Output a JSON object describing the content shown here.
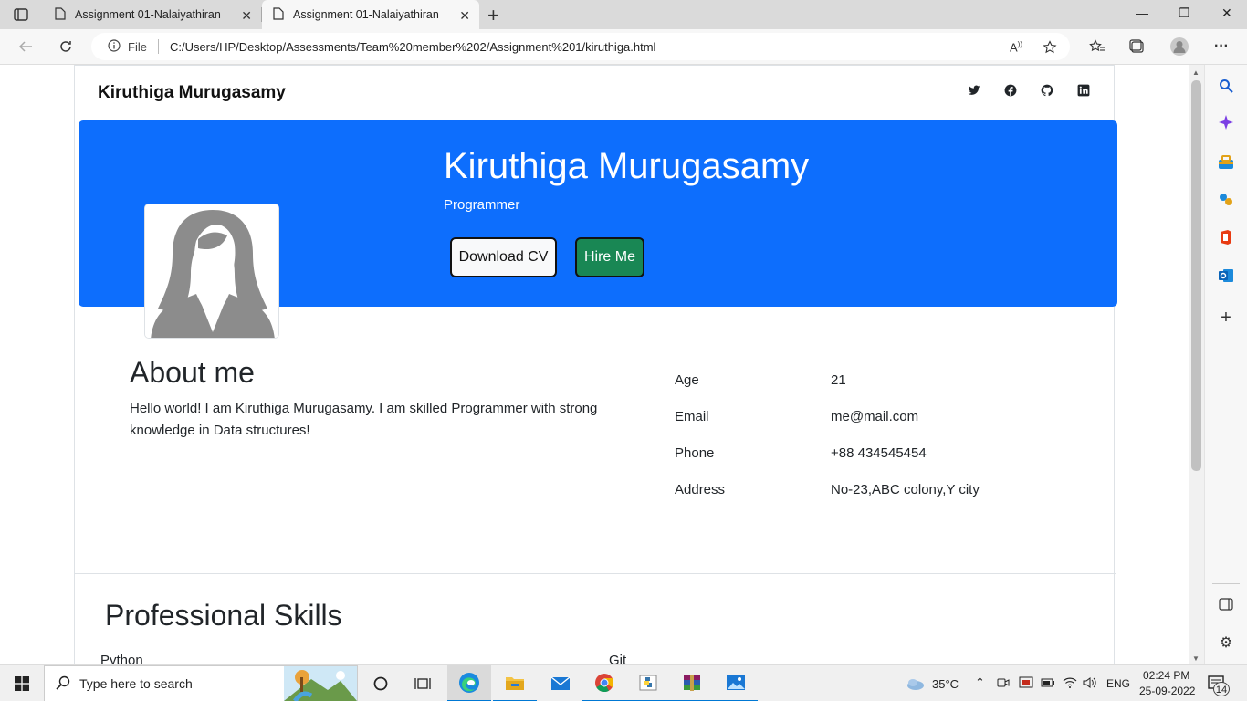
{
  "browser": {
    "tabs": [
      {
        "title": "Assignment 01-Nalaiyathiran",
        "active": false
      },
      {
        "title": "Assignment 01-Nalaiyathiran",
        "active": true
      }
    ],
    "url_label": "File",
    "url": "C:/Users/HP/Desktop/Assessments/Team%20member%202/Assignment%201/kiruthiga.html"
  },
  "page": {
    "brand": "Kiruthiga Murugasamy",
    "social_icons": [
      "twitter-icon",
      "facebook-icon",
      "github-icon",
      "linkedin-icon"
    ],
    "hero": {
      "name": "Kiruthiga Murugasamy",
      "role": "Programmer",
      "download_label": "Download CV",
      "hire_label": "Hire Me"
    },
    "about": {
      "title": "About me",
      "text": "Hello world! I am Kiruthiga Murugasamy. I am skilled Programmer with strong knowledge in Data structures!"
    },
    "info": [
      {
        "label": "Age",
        "value": "21"
      },
      {
        "label": "Email",
        "value": "me@mail.com"
      },
      {
        "label": "Phone",
        "value": "+88 434545454"
      },
      {
        "label": "Address",
        "value": "No-23,ABC colony,Y city"
      }
    ],
    "skills": {
      "title": "Professional Skills",
      "items": [
        "Python",
        "Git"
      ]
    }
  },
  "taskbar": {
    "search_placeholder": "Type here to search",
    "temperature": "35°C",
    "language": "ENG",
    "time": "02:24 PM",
    "date": "25-09-2022",
    "notification_count": "14"
  },
  "colors": {
    "hero_bg": "#0d6efd",
    "hire_btn": "#198754",
    "accent": "#0078d4"
  }
}
